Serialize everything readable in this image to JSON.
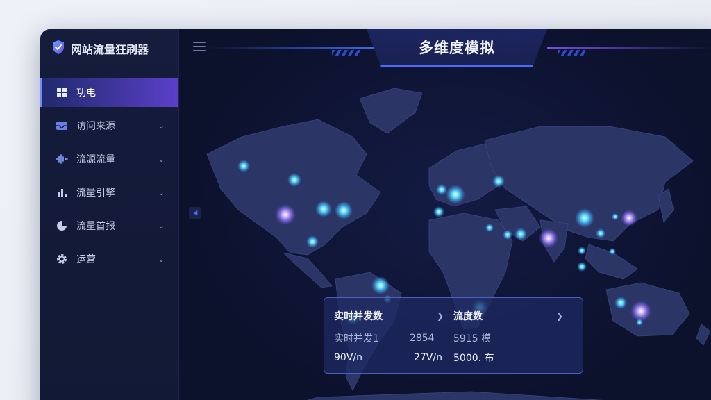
{
  "app": {
    "brand": "网站流量狂刷器",
    "title": "多维度模拟"
  },
  "sidebar": {
    "items": [
      {
        "label": "功电",
        "icon": "dashboard-icon",
        "active": true
      },
      {
        "label": "访问来源",
        "icon": "inbox-icon",
        "active": false
      },
      {
        "label": "流源流量",
        "icon": "waveform-icon",
        "active": false
      },
      {
        "label": "流量引擎",
        "icon": "bar-chart-icon",
        "active": false
      },
      {
        "label": "流量首报",
        "icon": "pie-chart-icon",
        "active": false
      },
      {
        "label": "运营",
        "icon": "gear-icon",
        "active": false
      }
    ]
  },
  "stats": {
    "header_left": "实时并发数",
    "header_right": "流度数",
    "row2": {
      "a": "实时并发1",
      "b": "2854",
      "c": "5915 模"
    },
    "row3": {
      "a": "90V/n",
      "b": "27V/n",
      "c": "5000. 布"
    }
  },
  "colors": {
    "accent": "#5b3fc9",
    "node_cyan": "#44d4ff",
    "node_purple": "#b08cff",
    "continent": "#2b3566"
  }
}
